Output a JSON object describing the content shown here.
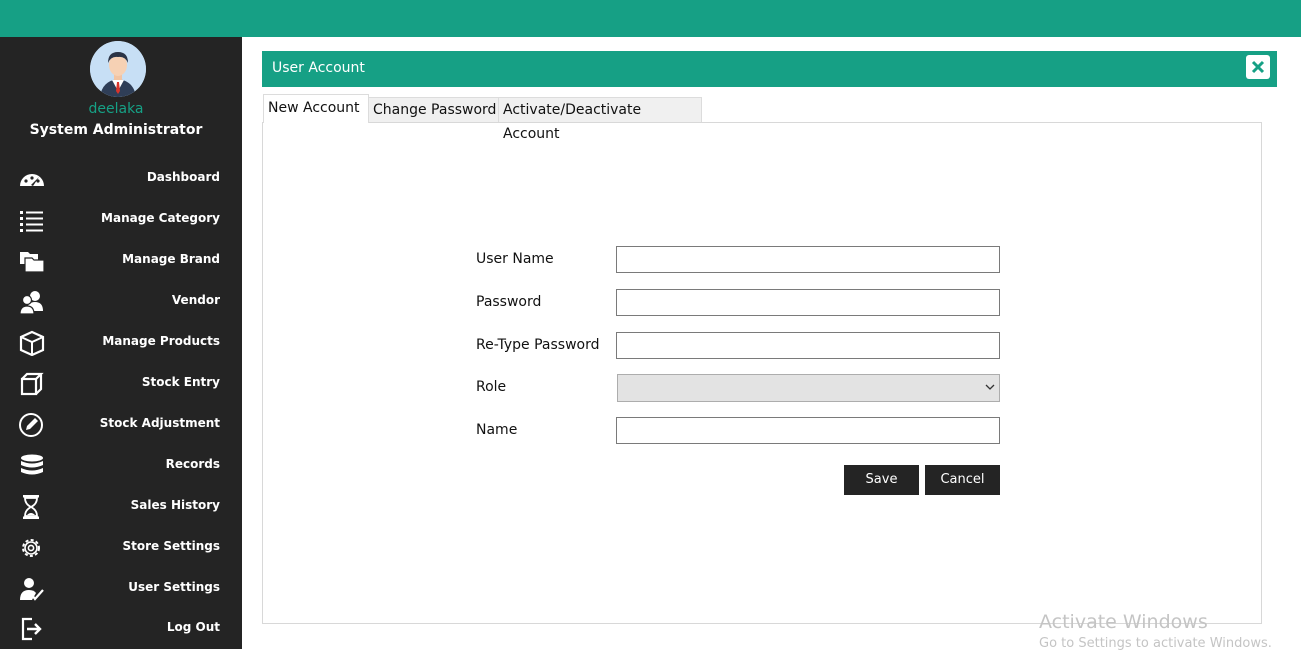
{
  "profile": {
    "username": "deelaka",
    "role": "System Administrator"
  },
  "nav": [
    {
      "label": "Dashboard",
      "icon": "dashboard-icon"
    },
    {
      "label": "Manage Category",
      "icon": "list-icon"
    },
    {
      "label": "Manage Brand",
      "icon": "folders-icon"
    },
    {
      "label": "Vendor",
      "icon": "users-icon"
    },
    {
      "label": "Manage Products",
      "icon": "box-icon"
    },
    {
      "label": "Stock Entry",
      "icon": "stock-entry-icon"
    },
    {
      "label": "Stock Adjustment",
      "icon": "edit-circle-icon"
    },
    {
      "label": "Records",
      "icon": "database-icon"
    },
    {
      "label": "Sales History",
      "icon": "hourglass-icon"
    },
    {
      "label": "Store Settings",
      "icon": "gear-icon"
    },
    {
      "label": "User Settings",
      "icon": "user-check-icon"
    },
    {
      "label": "Log Out",
      "icon": "logout-icon"
    }
  ],
  "panel": {
    "title": "User Account",
    "close_icon": "close-icon"
  },
  "tabs": [
    {
      "label": "New Account",
      "active": true
    },
    {
      "label": "Change Password",
      "active": false
    },
    {
      "label": "Activate/Deactivate Account",
      "active": false
    }
  ],
  "form": {
    "username_label": "User Name",
    "username_value": "",
    "password_label": "Password",
    "password_value": "",
    "retype_label": "Re-Type Password",
    "retype_value": "",
    "role_label": "Role",
    "role_value": "",
    "name_label": "Name",
    "name_value": ""
  },
  "buttons": {
    "save": "Save",
    "cancel": "Cancel"
  },
  "watermark": {
    "title": "Activate Windows",
    "subtitle": "Go to Settings to activate Windows."
  },
  "colors": {
    "accent": "#16a085",
    "sidebar": "#242424",
    "topbar": "#16a085"
  }
}
